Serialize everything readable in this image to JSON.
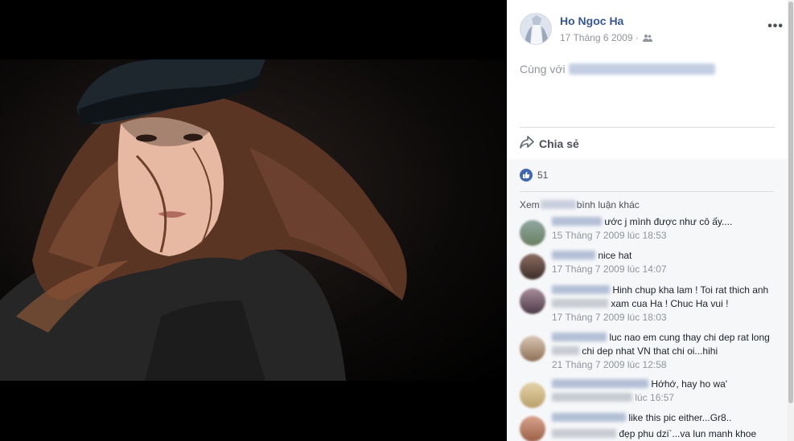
{
  "post": {
    "author": "Ho Ngoc Ha",
    "date": "17 Tháng 6 2009 · ",
    "privacy_icon": "people-icon",
    "more_label": "•••",
    "with_prefix": "Cùng với",
    "share_label": "Chia sẻ",
    "like_count": "51"
  },
  "comments_section": {
    "view_more_prefix": "Xem",
    "view_more_suffix": "bình luận khác"
  },
  "comments": [
    {
      "text": "ước j mình được như cô ấy....",
      "time": "15 Tháng 7 2009 lúc 18:53"
    },
    {
      "text": "nice hat",
      "time": "17 Tháng 7 2009 lúc 14:07"
    },
    {
      "text": "Hinh chup kha lam ! Toi rat thich anh",
      "text_line2_suffix": "xam cua Ha ! Chuc Ha vui !",
      "time": "17 Tháng 7 2009 lúc 18:03"
    },
    {
      "text": "luc nao em cung thay chi dep rat long",
      "text_line2_suffix": "chi dep nhat VN that chi oi...hihi",
      "time": "21 Tháng 7 2009 lúc 12:58"
    },
    {
      "text": "Hớhớ, hay ho wa'",
      "time_suffix": "lúc 16:57"
    },
    {
      "text": "like this pic either...Gr8..",
      "text_line2": "đẹp phu dzi`...va lun manh khoe"
    }
  ],
  "colors": {
    "link": "#365899",
    "meta": "#90949c",
    "like_blue": "#4267b2"
  }
}
